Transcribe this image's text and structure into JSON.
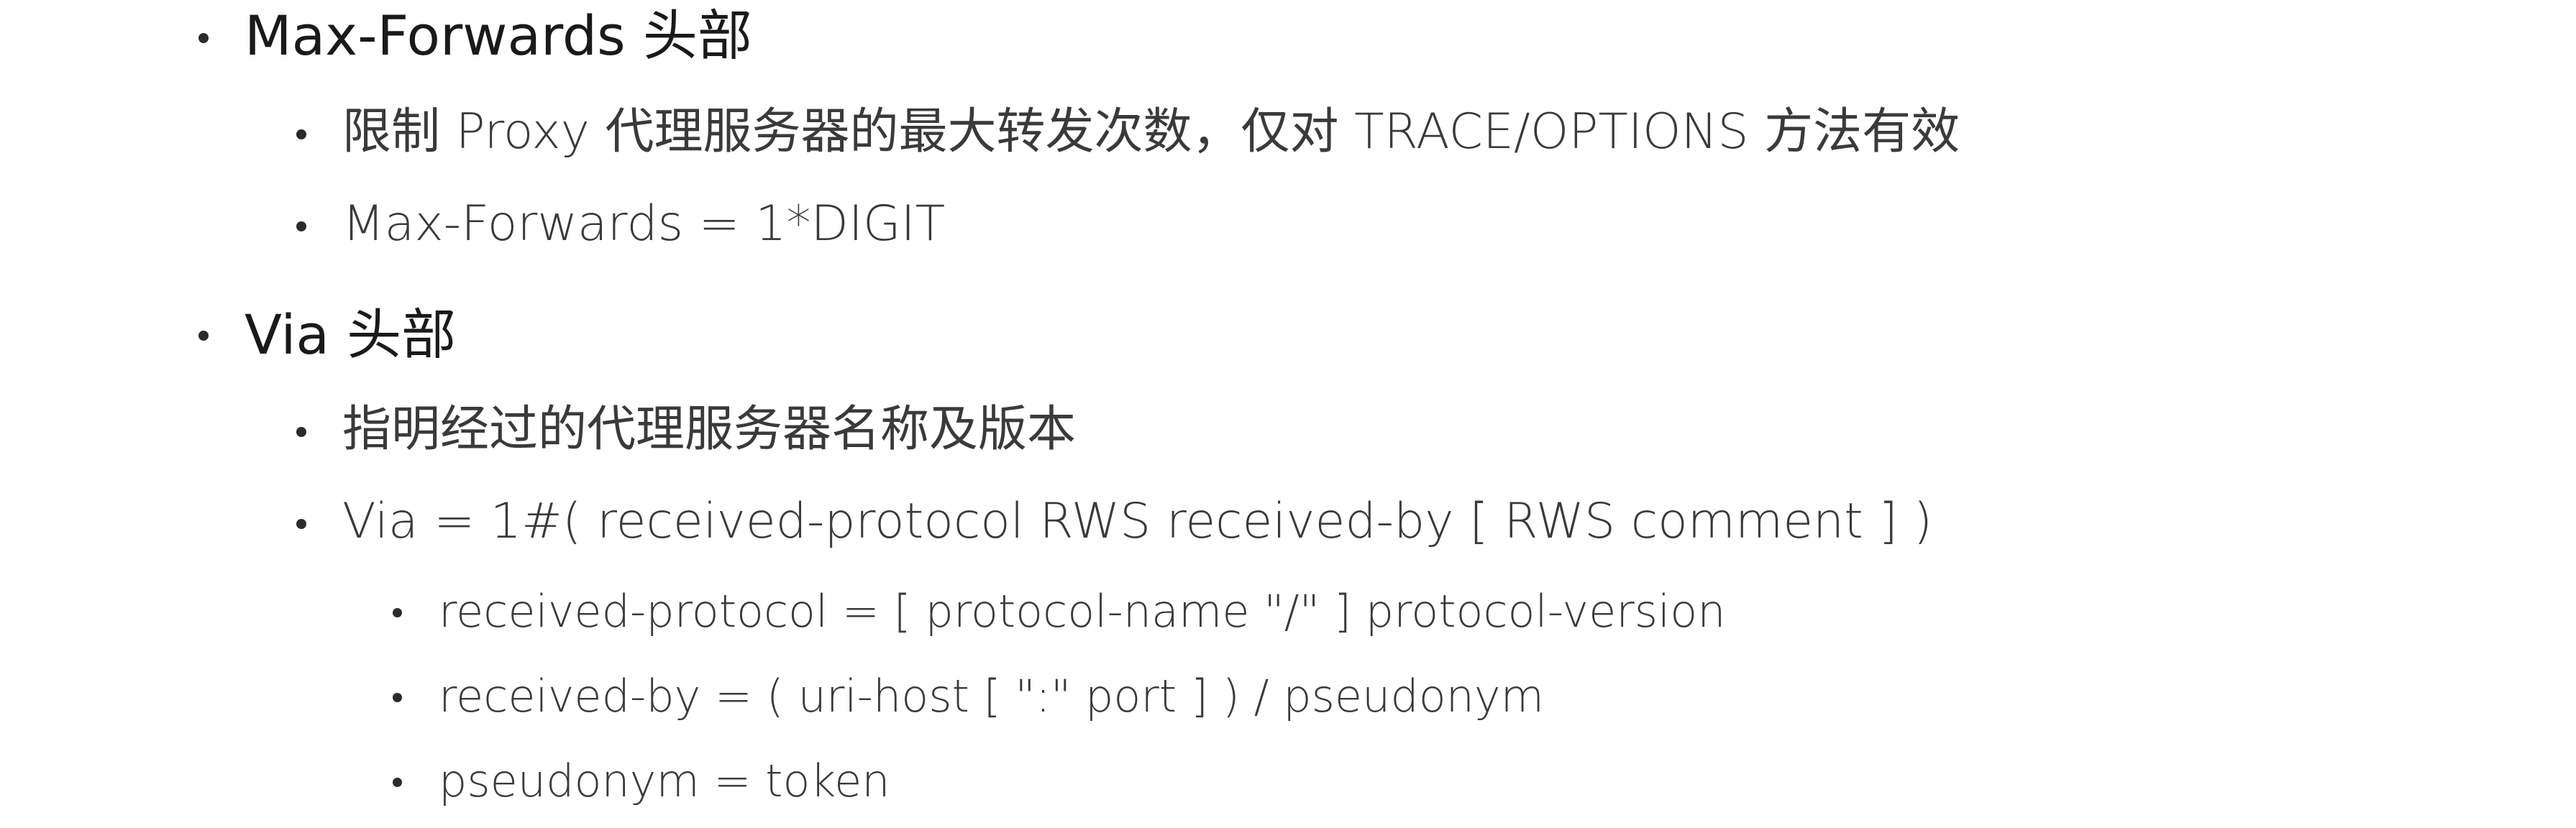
{
  "slide": {
    "items": [
      {
        "label": "Max-Forwards 头部"
      },
      {
        "label": "限制 Proxy 代理服务器的最大转发次数，仅对 TRACE/OPTIONS 方法有效"
      },
      {
        "label": "Max-Forwards = 1*DIGIT"
      },
      {
        "label": "Via 头部"
      },
      {
        "label": "指明经过的代理服务器名称及版本"
      },
      {
        "label": "Via = 1#( received-protocol RWS received-by [ RWS comment ] )"
      },
      {
        "label": "received-protocol = [ protocol-name \"/\" ] protocol-version"
      },
      {
        "label": "received-by = ( uri-host [ \":\" port ] ) / pseudonym"
      },
      {
        "label": "pseudonym = token"
      }
    ]
  }
}
